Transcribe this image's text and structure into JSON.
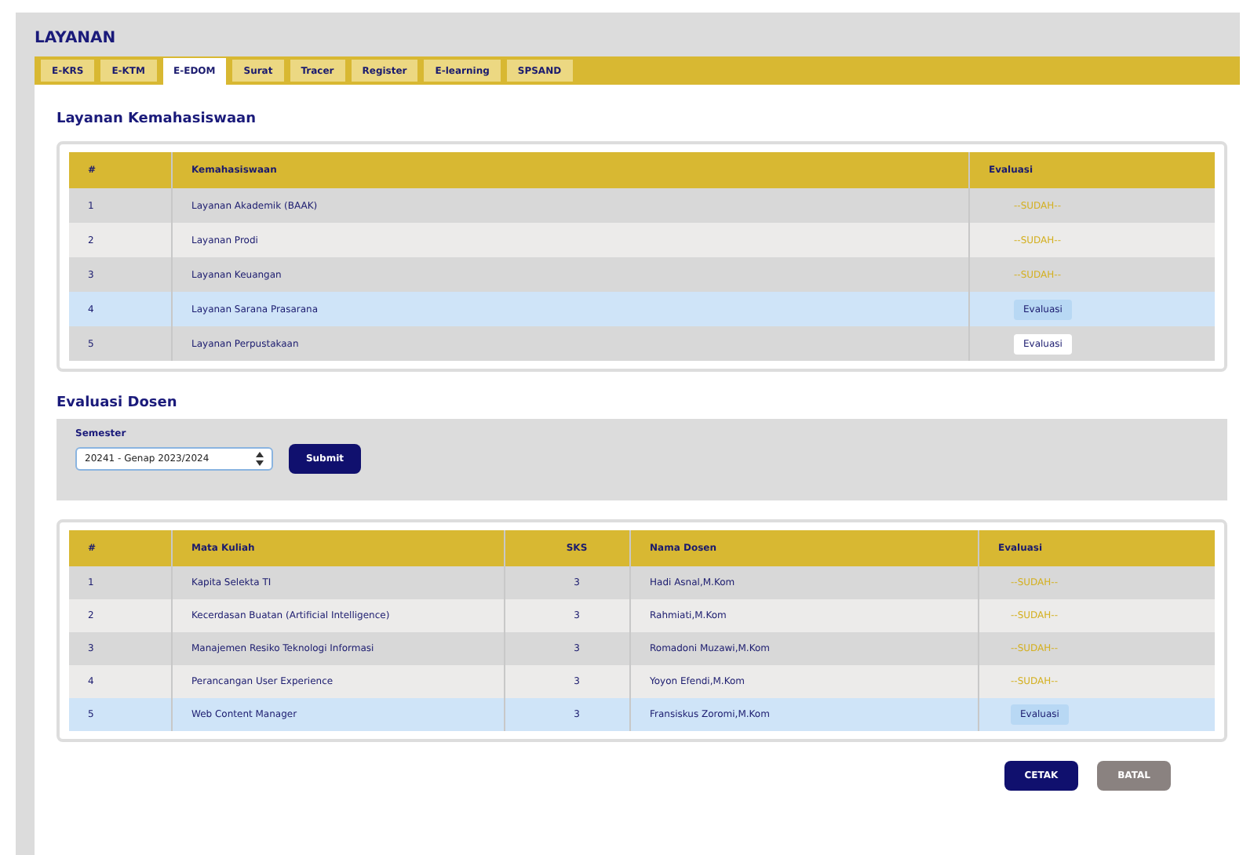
{
  "page_title": "LAYANAN",
  "tabs": [
    {
      "label": "E-KRS",
      "selected": false
    },
    {
      "label": "E-KTM",
      "selected": false
    },
    {
      "label": "E-EDOM",
      "selected": true
    },
    {
      "label": "Surat",
      "selected": false
    },
    {
      "label": "Tracer",
      "selected": false
    },
    {
      "label": "Register",
      "selected": false
    },
    {
      "label": "E-learning",
      "selected": false
    },
    {
      "label": "SPSAND",
      "selected": false
    }
  ],
  "services": {
    "title": "Layanan Kemahasiswaan",
    "columns": [
      "#",
      "Kemahasiswaan",
      "Evaluasi"
    ],
    "rows": [
      {
        "no": "1",
        "name": "Layanan Akademik (BAAK)",
        "kind": "done",
        "evaluation": "--SUDAH--",
        "selected": false
      },
      {
        "no": "2",
        "name": "Layanan Prodi",
        "kind": "done",
        "evaluation": "--SUDAH--",
        "selected": false
      },
      {
        "no": "3",
        "name": "Layanan Keuangan",
        "kind": "done",
        "evaluation": "--SUDAH--",
        "selected": false
      },
      {
        "no": "4",
        "name": "Layanan Sarana Prasarana",
        "kind": "pending",
        "evaluation": "Evaluasi",
        "selected": true
      },
      {
        "no": "5",
        "name": "Layanan Perpustakaan",
        "kind": "pending",
        "evaluation": "Evaluasi",
        "selected": false
      }
    ]
  },
  "lecturers": {
    "title": "Evaluasi Dosen",
    "semester_label": "Semester",
    "semester_value": "20241 - Genap 2023/2024",
    "submit": "Submit",
    "columns": [
      "#",
      "Mata Kuliah",
      "SKS",
      "Nama Dosen",
      "Evaluasi"
    ],
    "rows": [
      {
        "no": "1",
        "course": "Kapita Selekta TI",
        "sks": "3",
        "lecturer": "Hadi Asnal,M.Kom",
        "kind": "done",
        "evaluation": "--SUDAH--",
        "selected": false
      },
      {
        "no": "2",
        "course": "Kecerdasan Buatan (Artificial Intelligence)",
        "sks": "3",
        "lecturer": "Rahmiati,M.Kom",
        "kind": "done",
        "evaluation": "--SUDAH--",
        "selected": false
      },
      {
        "no": "3",
        "course": "Manajemen Resiko Teknologi Informasi",
        "sks": "3",
        "lecturer": "Romadoni Muzawi,M.Kom",
        "kind": "done",
        "evaluation": "--SUDAH--",
        "selected": false
      },
      {
        "no": "4",
        "course": "Perancangan User Experience",
        "sks": "3",
        "lecturer": "Yoyon Efendi,M.Kom",
        "kind": "done",
        "evaluation": "--SUDAH--",
        "selected": false
      },
      {
        "no": "5",
        "course": "Web Content Manager",
        "sks": "3",
        "lecturer": "Fransiskus Zoromi,M.Kom",
        "kind": "pending",
        "evaluation": "Evaluasi",
        "selected": true
      }
    ]
  },
  "buttons": {
    "print": "CETAK",
    "cancel": "BATAL"
  }
}
